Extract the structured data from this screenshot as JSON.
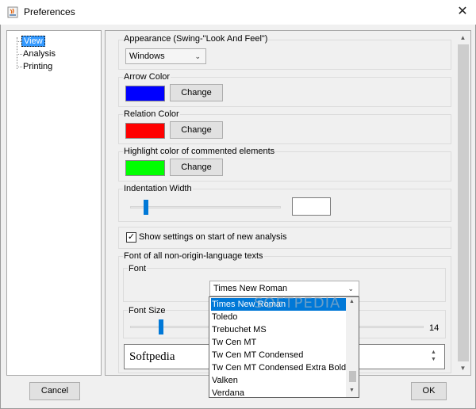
{
  "window": {
    "title": "Preferences",
    "close_glyph": "✕"
  },
  "tree": {
    "items": [
      "View",
      "Analysis",
      "Printing"
    ],
    "selected": "View"
  },
  "appearance": {
    "label": "Appearance (Swing-\"Look And Feel\")",
    "value": "Windows"
  },
  "arrow_color": {
    "label": "Arrow Color",
    "swatch": "#0000ff",
    "button": "Change"
  },
  "relation_color": {
    "label": "Relation Color",
    "swatch": "#ff0000",
    "button": "Change"
  },
  "highlight_color": {
    "label": "Highlight color of commented elements",
    "swatch": "#00ff00",
    "button": "Change"
  },
  "indentation": {
    "label": "Indentation Width",
    "value": ""
  },
  "show_settings": {
    "label": "Show settings on start of new analysis",
    "checked": true,
    "check_glyph": "✓"
  },
  "font_section": {
    "label": "Font of all non-origin-language texts",
    "font_label": "Font",
    "font_value": "Times New Roman",
    "font_size_label": "Font Size",
    "font_size_value": "14",
    "preview_text": "Softpedia"
  },
  "font_dropdown": {
    "options": [
      "Times New Roman",
      "Toledo",
      "Trebuchet MS",
      "Tw Cen MT",
      "Tw Cen MT Condensed",
      "Tw Cen MT Condensed Extra Bold",
      "Valken",
      "Verdana"
    ],
    "selected": "Times New Roman"
  },
  "buttons": {
    "cancel": "Cancel",
    "ok": "OK"
  },
  "watermark": "SOFTPEDIA",
  "icons": {
    "app": "java-icon",
    "close": "close-icon",
    "chevron": "chevron-down-icon"
  }
}
